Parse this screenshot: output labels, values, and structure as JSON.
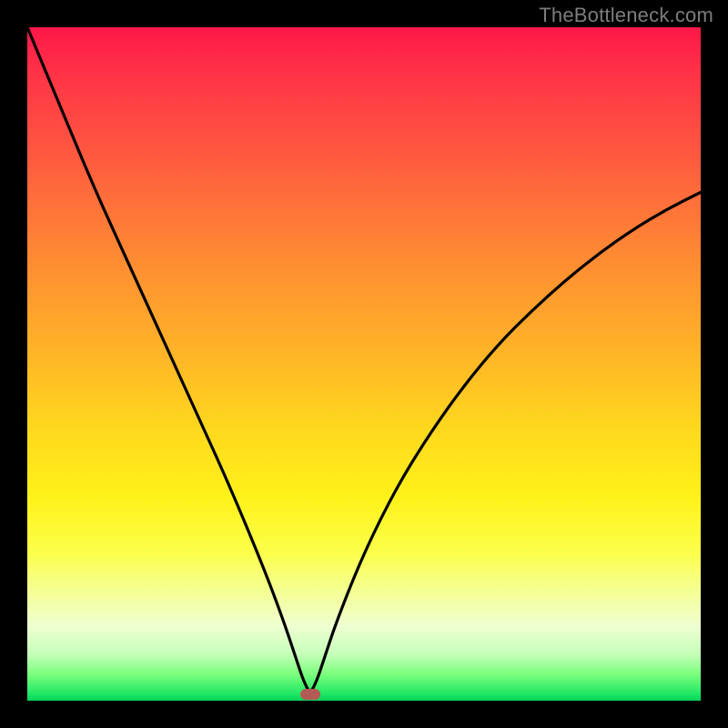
{
  "watermark": "TheBottleneck.com",
  "colors": {
    "frame": "#000000",
    "curve": "#000000",
    "marker": "#b45a55",
    "watermark": "#7d7d7d"
  },
  "chart_data": {
    "type": "line",
    "title": "",
    "xlabel": "",
    "ylabel": "",
    "xlim": [
      0,
      100
    ],
    "ylim": [
      0,
      100
    ],
    "grid": false,
    "legend": false,
    "annotations": [],
    "marker": {
      "x": 42,
      "y": 1
    },
    "series": [
      {
        "name": "curve",
        "x": [
          0,
          5,
          10,
          15,
          20,
          25,
          30,
          35,
          38,
          40,
          41,
          42,
          43,
          44,
          46,
          50,
          55,
          60,
          65,
          70,
          75,
          80,
          85,
          90,
          95,
          100
        ],
        "y": [
          100,
          88,
          76,
          65,
          54,
          43,
          32,
          20,
          12,
          6,
          3,
          1,
          3,
          6,
          12,
          22,
          32,
          40,
          47,
          53,
          58,
          62.5,
          66.5,
          70,
          73,
          75.5
        ]
      }
    ]
  }
}
